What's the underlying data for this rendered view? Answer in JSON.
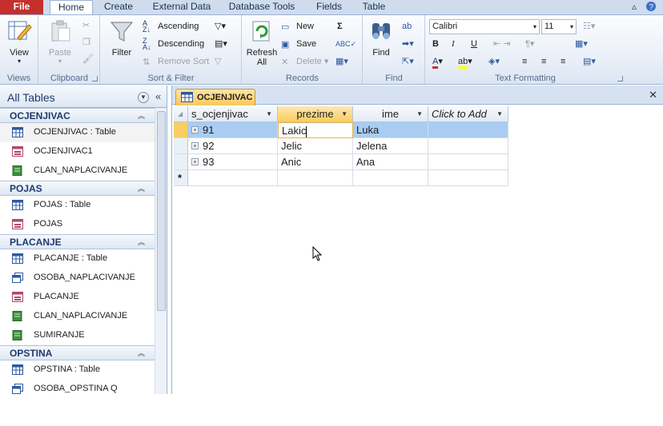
{
  "tabs": {
    "file": "File",
    "home": "Home",
    "create": "Create",
    "external": "External Data",
    "dbtools": "Database Tools",
    "fields": "Fields",
    "table": "Table"
  },
  "ribbon": {
    "views": {
      "view": "View",
      "label": "Views"
    },
    "clipboard": {
      "paste": "Paste",
      "label": "Clipboard"
    },
    "sort_filter": {
      "filter": "Filter",
      "ascending": "Ascending",
      "descending": "Descending",
      "remove_sort": "Remove Sort",
      "label": "Sort & Filter"
    },
    "records": {
      "refresh": "Refresh",
      "refresh_sub": "All",
      "new": "New",
      "save": "Save",
      "delete": "Delete",
      "label": "Records"
    },
    "find": {
      "find": "Find",
      "label": "Find"
    },
    "text_formatting": {
      "font": "Calibri",
      "size": "11",
      "bold": "B",
      "italic": "I",
      "underline": "U",
      "label": "Text Formatting"
    }
  },
  "nav": {
    "title": "All Tables",
    "sections": [
      {
        "title": "OCJENJIVAC",
        "items": [
          {
            "label": "OCJENJIVAC : Table",
            "icon": "table-icon",
            "selected": true
          },
          {
            "label": "OCJENJIVAC1",
            "icon": "form-icon"
          },
          {
            "label": "CLAN_NAPLACIVANJE",
            "icon": "report-icon"
          }
        ]
      },
      {
        "title": "POJAS",
        "items": [
          {
            "label": "POJAS : Table",
            "icon": "table-icon"
          },
          {
            "label": "POJAS",
            "icon": "form-icon"
          }
        ]
      },
      {
        "title": "PLACANJE",
        "items": [
          {
            "label": "PLACANJE : Table",
            "icon": "table-icon"
          },
          {
            "label": "OSOBA_NAPLACIVANJE",
            "icon": "query-icon"
          },
          {
            "label": "PLACANJE",
            "icon": "form-icon"
          },
          {
            "label": "CLAN_NAPLACIVANJE",
            "icon": "report-icon"
          },
          {
            "label": "SUMIRANJE",
            "icon": "report-icon"
          }
        ]
      },
      {
        "title": "OPSTINA",
        "items": [
          {
            "label": "OPSTINA : Table",
            "icon": "table-icon"
          },
          {
            "label": "OSOBA_OPSTINA Q",
            "icon": "query-icon"
          }
        ]
      }
    ]
  },
  "doc": {
    "tab_label": "OCJENJIVAC",
    "columns": [
      "s_ocjenjivac",
      "prezime",
      "ime",
      "Click to Add"
    ],
    "rows": [
      [
        "91",
        "Lakic",
        "Luka"
      ],
      [
        "92",
        "Jelic",
        "Jelena"
      ],
      [
        "93",
        "Anic",
        "Ana"
      ]
    ],
    "new_row_marker": "*"
  },
  "colors": {
    "file_tab": "#c5302c",
    "active_col": "#f9cd62",
    "selected_row": "#a9cdf2"
  }
}
